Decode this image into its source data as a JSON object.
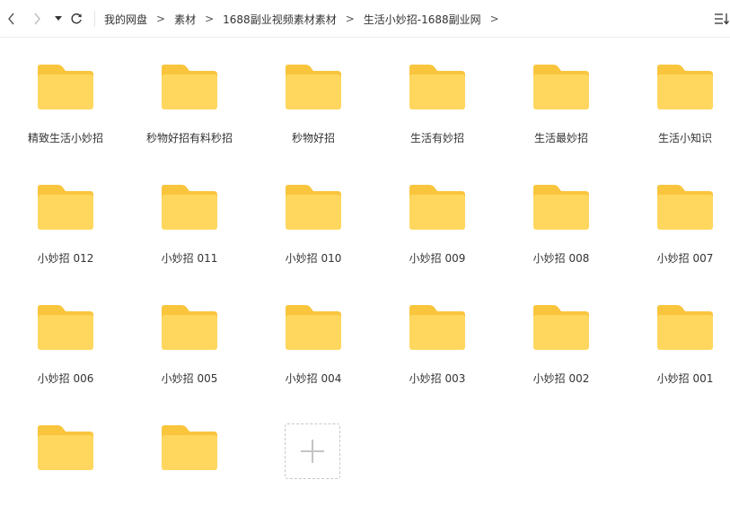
{
  "toolbar": {
    "back_icon": "chevron-left-icon",
    "forward_icon": "chevron-right-icon",
    "dropdown_icon": "caret-down-icon",
    "refresh_icon": "refresh-icon",
    "view_icon": "list-sort-icon",
    "breadcrumb": [
      "我的网盘",
      "素材",
      "1688副业视频素材素材",
      "生活小妙招-1688副业网"
    ],
    "separator": ">"
  },
  "folders": [
    {
      "label": "精致生活小妙招"
    },
    {
      "label": "秒物好招有料秒招"
    },
    {
      "label": "秒物好招"
    },
    {
      "label": "生活有妙招"
    },
    {
      "label": "生活最妙招"
    },
    {
      "label": "生活小知识"
    },
    {
      "label": "小妙招 012"
    },
    {
      "label": "小妙招 011"
    },
    {
      "label": "小妙招 010"
    },
    {
      "label": "小妙招 009"
    },
    {
      "label": "小妙招 008"
    },
    {
      "label": "小妙招 007"
    },
    {
      "label": "小妙招 006"
    },
    {
      "label": "小妙招 005"
    },
    {
      "label": "小妙招 004"
    },
    {
      "label": "小妙招 003"
    },
    {
      "label": "小妙招 002"
    },
    {
      "label": "小妙招 001"
    },
    {
      "label": ""
    },
    {
      "label": ""
    }
  ],
  "add_tile_icon": "plus-icon",
  "colors": {
    "folder_body": "#FFD75E",
    "folder_tab": "#F9C53D",
    "text": "#333333"
  }
}
